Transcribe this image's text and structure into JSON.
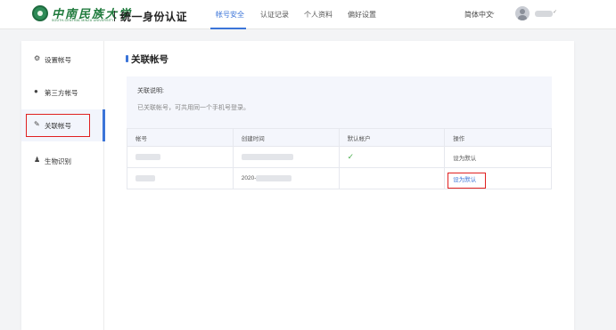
{
  "header": {
    "logo_cn": "中南民族大学",
    "logo_en": "SOUTH-CENTRAL MINZU UNIVERSITY",
    "site_title": "统一身份认证",
    "tabs": [
      {
        "label": "帐号安全",
        "active": true
      },
      {
        "label": "认证记录",
        "active": false
      },
      {
        "label": "个人资料",
        "active": false
      },
      {
        "label": "偏好设置",
        "active": false
      }
    ],
    "language": "简体中文",
    "accent_color": "#3b74d8"
  },
  "sidebar": {
    "items": [
      {
        "label": "设置帐号",
        "icon": "gear-icon",
        "active": false
      },
      {
        "label": "第三方帐号",
        "icon": "link-circle-icon",
        "active": false
      },
      {
        "label": "关联帐号",
        "icon": "edit-icon",
        "active": true
      },
      {
        "label": "生物识别",
        "icon": "person-icon",
        "active": false
      }
    ]
  },
  "main": {
    "title": "关联帐号",
    "notice": {
      "title": "关联说明:",
      "text": "已关联帐号，可共用同一个手机号登录。"
    },
    "table": {
      "headers": [
        "帐号",
        "创建时间",
        "默认帐户",
        "操作"
      ],
      "rows": [
        {
          "account": "",
          "created": "",
          "is_default": true,
          "action": "设为默认"
        },
        {
          "account": "",
          "created": "2020-",
          "is_default": false,
          "action": "设为默认"
        }
      ]
    }
  },
  "highlight_color": "#e02020"
}
